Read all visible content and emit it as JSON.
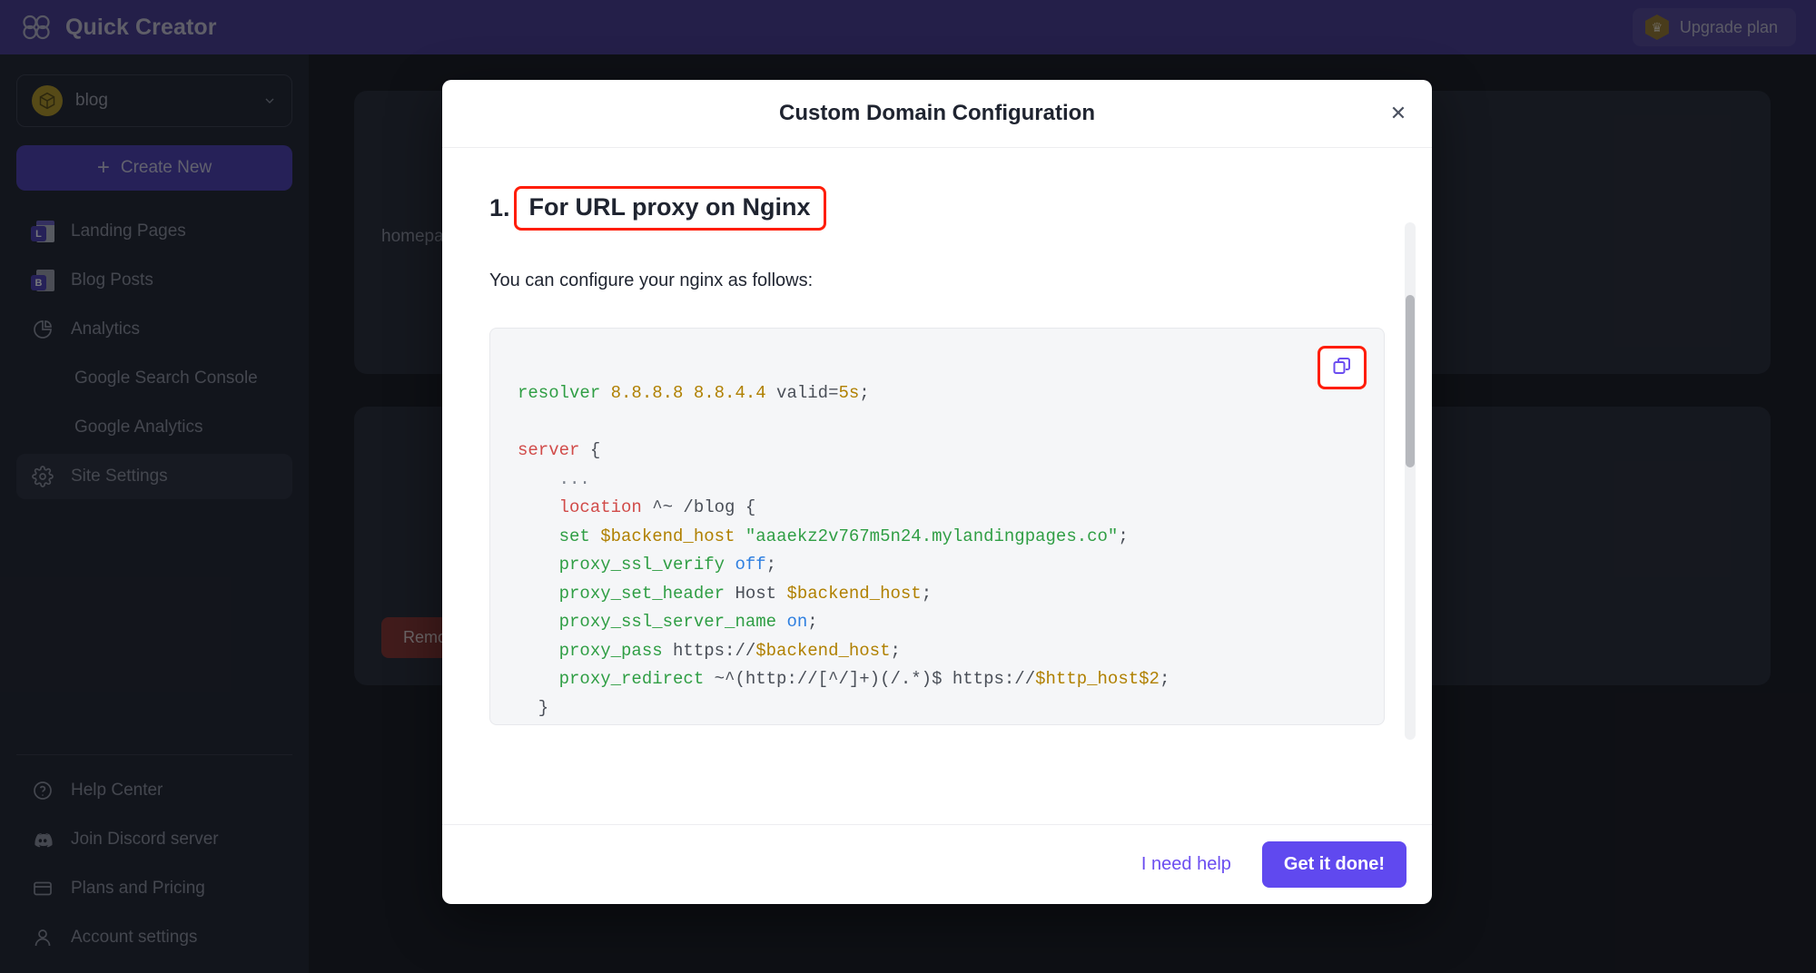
{
  "topbar": {
    "brand_name": "Quick Creator",
    "logo_icon": "infinity-loop-logo-icon",
    "upgrade_label": "Upgrade plan",
    "crown_icon": "crown-icon"
  },
  "sidebar": {
    "site_selector": {
      "name": "blog",
      "avatar_icon": "cube-icon",
      "chevron_icon": "chevron-down-icon"
    },
    "create_button": {
      "label": "Create New",
      "icon": "plus-icon"
    },
    "items": [
      {
        "label": "Landing Pages",
        "icon": "landing-page-icon",
        "badge": "L",
        "active": false,
        "sub": false
      },
      {
        "label": "Blog Posts",
        "icon": "blog-post-icon",
        "badge": "B",
        "active": false,
        "sub": false
      },
      {
        "label": "Analytics",
        "icon": "pie-chart-icon",
        "active": false,
        "sub": false
      },
      {
        "label": "Google Search Console",
        "icon": "",
        "active": false,
        "sub": true
      },
      {
        "label": "Google Analytics",
        "icon": "",
        "active": false,
        "sub": true
      },
      {
        "label": "Site Settings",
        "icon": "gear-icon",
        "active": true,
        "sub": false
      }
    ],
    "bottom_items": [
      {
        "label": "Help Center",
        "icon": "question-circle-icon"
      },
      {
        "label": "Join Discord server",
        "icon": "discord-icon"
      },
      {
        "label": "Plans and Pricing",
        "icon": "credit-card-icon"
      },
      {
        "label": "Account settings",
        "icon": "user-icon"
      }
    ]
  },
  "page": {
    "card_text": "homepage in the",
    "remove_label": "Remove"
  },
  "modal": {
    "title": "Custom Domain Configuration",
    "close_icon": "close-icon",
    "step_number": "1.",
    "step_title": "For URL proxy on Nginx",
    "intro": "You can configure your nginx as follows:",
    "copy_icon": "copy-icon",
    "code_lines": [
      {
        "tokens": [
          {
            "t": "resolver ",
            "c": "dir"
          },
          {
            "t": "8.8.8.8 8.8.4.4",
            "c": "num"
          },
          {
            "t": " valid=",
            "c": "plain"
          },
          {
            "t": "5s",
            "c": "num"
          },
          {
            "t": ";",
            "c": "plain"
          }
        ]
      },
      {
        "tokens": []
      },
      {
        "tokens": [
          {
            "t": "server",
            "c": "kw"
          },
          {
            "t": " {",
            "c": "plain"
          }
        ]
      },
      {
        "tokens": [
          {
            "t": "    ...",
            "c": "dim"
          }
        ]
      },
      {
        "tokens": [
          {
            "t": "    ",
            "c": "plain"
          },
          {
            "t": "location",
            "c": "kw"
          },
          {
            "t": " ^~ /blog {",
            "c": "plain"
          }
        ]
      },
      {
        "tokens": [
          {
            "t": "    ",
            "c": "plain"
          },
          {
            "t": "set ",
            "c": "dir"
          },
          {
            "t": "$backend_host",
            "c": "var"
          },
          {
            "t": " ",
            "c": "plain"
          },
          {
            "t": "\"aaaekz2v767m5n24.mylandingpages.co\"",
            "c": "str"
          },
          {
            "t": ";",
            "c": "plain"
          }
        ]
      },
      {
        "tokens": [
          {
            "t": "    ",
            "c": "plain"
          },
          {
            "t": "proxy_ssl_verify ",
            "c": "dir"
          },
          {
            "t": "off",
            "c": "bool"
          },
          {
            "t": ";",
            "c": "plain"
          }
        ]
      },
      {
        "tokens": [
          {
            "t": "    ",
            "c": "plain"
          },
          {
            "t": "proxy_set_header ",
            "c": "dir"
          },
          {
            "t": "Host ",
            "c": "plain"
          },
          {
            "t": "$backend_host",
            "c": "var"
          },
          {
            "t": ";",
            "c": "plain"
          }
        ]
      },
      {
        "tokens": [
          {
            "t": "    ",
            "c": "plain"
          },
          {
            "t": "proxy_ssl_server_name ",
            "c": "dir"
          },
          {
            "t": "on",
            "c": "bool"
          },
          {
            "t": ";",
            "c": "plain"
          }
        ]
      },
      {
        "tokens": [
          {
            "t": "    ",
            "c": "plain"
          },
          {
            "t": "proxy_pass ",
            "c": "dir"
          },
          {
            "t": "https://",
            "c": "plain"
          },
          {
            "t": "$backend_host",
            "c": "var"
          },
          {
            "t": ";",
            "c": "plain"
          }
        ]
      },
      {
        "tokens": [
          {
            "t": "    ",
            "c": "plain"
          },
          {
            "t": "proxy_redirect ",
            "c": "dir"
          },
          {
            "t": "~^(http://[^/]+)(/.*)$ https://",
            "c": "plain"
          },
          {
            "t": "$http_host$2",
            "c": "var"
          },
          {
            "t": ";",
            "c": "plain"
          }
        ]
      },
      {
        "tokens": [
          {
            "t": "  }",
            "c": "plain"
          }
        ]
      },
      {
        "tokens": [
          {
            "t": "...",
            "c": "dim"
          }
        ]
      },
      {
        "tokens": [
          {
            "t": "}",
            "c": "plain"
          }
        ]
      }
    ],
    "footer": {
      "help_label": "I need help",
      "done_label": "Get it done!"
    }
  },
  "colors": {
    "brand_purple": "#473b93",
    "accent_purple": "#6049ef",
    "highlight_red": "#ff1d08",
    "danger_red": "#8b3430"
  }
}
